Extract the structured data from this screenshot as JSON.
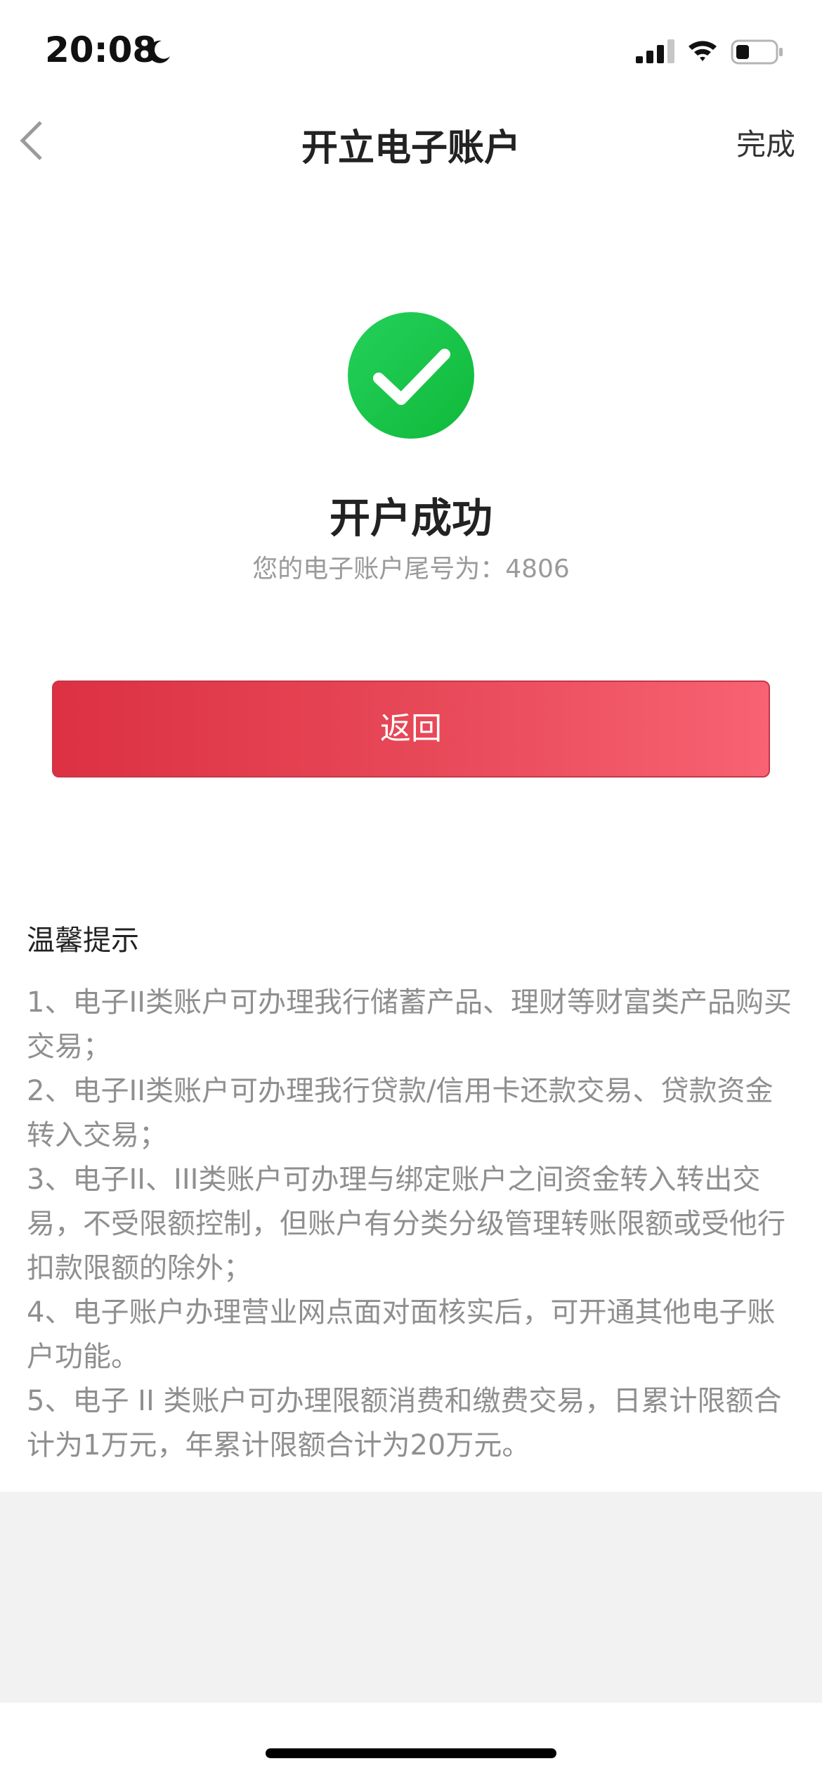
{
  "status_bar": {
    "time": "20:08",
    "icons": [
      "moon-icon",
      "signal-icon",
      "wifi-icon",
      "battery-icon"
    ]
  },
  "nav": {
    "title": "开立电子账户",
    "done_label": "完成",
    "back_icon": "chevron-left-icon"
  },
  "success": {
    "icon": "check-circle-icon",
    "icon_color": "#1bc446",
    "title": "开户成功",
    "subtitle": "您的电子账户尾号为：4806"
  },
  "return_button": {
    "label": "返回",
    "color": "#e43f50"
  },
  "tips": {
    "title": "温馨提示",
    "items": [
      "1、电子II类账户可办理我行储蓄产品、理财等财富类产品购买交易；",
      "2、电子II类账户可办理我行贷款/信用卡还款交易、贷款资金转入交易；",
      "3、电子II、III类账户可办理与绑定账户之间资金转入转出交易，不受限额控制，但账户有分类分级管理转账限额或受他行扣款限额的除外；",
      "4、电子账户办理营业网点面对面核实后，可开通其他电子账户功能。",
      "5、电子 II 类账户可办理限额消费和缴费交易，日累计限额合计为1万元，年累计限额合计为20万元。"
    ]
  }
}
